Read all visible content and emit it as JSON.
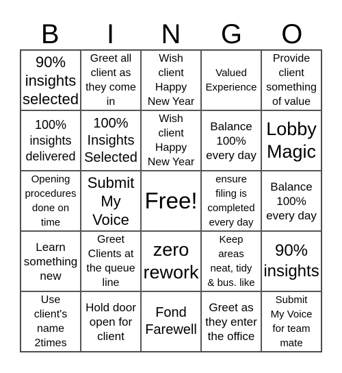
{
  "title_letters": [
    "B",
    "I",
    "N",
    "G",
    "O"
  ],
  "cells": [
    [
      "90%\ninsights\nselected",
      "Greet all\nclient as\nthey come\nin",
      "Wish\nclient\nHappy\nNew Year",
      "Valued\nExperience",
      "Provide\nclient\nsomething\nof value"
    ],
    [
      "100%\ninsights\ndelivered",
      "100%\nInsights\nSelected",
      "Wish\nclient\nHappy\nNew Year",
      "Balance\n100%\nevery day",
      "Lobby\nMagic"
    ],
    [
      "Opening\nprocedures\ndone on\ntime",
      "Submit\nMy\nVoice",
      "Free!",
      "ensure\nfiling is\ncompleted\nevery day",
      "Balance\n100%\nevery day"
    ],
    [
      "Learn\nsomething\nnew",
      "Greet\nClients at\nthe queue\nline",
      "zero\nrework",
      "Keep\nareas\nneat, tidy\n& bus. like",
      "90%\ninsights"
    ],
    [
      "Use\nclient's\nname\n2times",
      "Hold door\nopen for\nclient",
      "Fond\nFarewell",
      "Greet as\nthey enter\nthe office",
      "Submit\nMy Voice\nfor team\nmate"
    ]
  ]
}
